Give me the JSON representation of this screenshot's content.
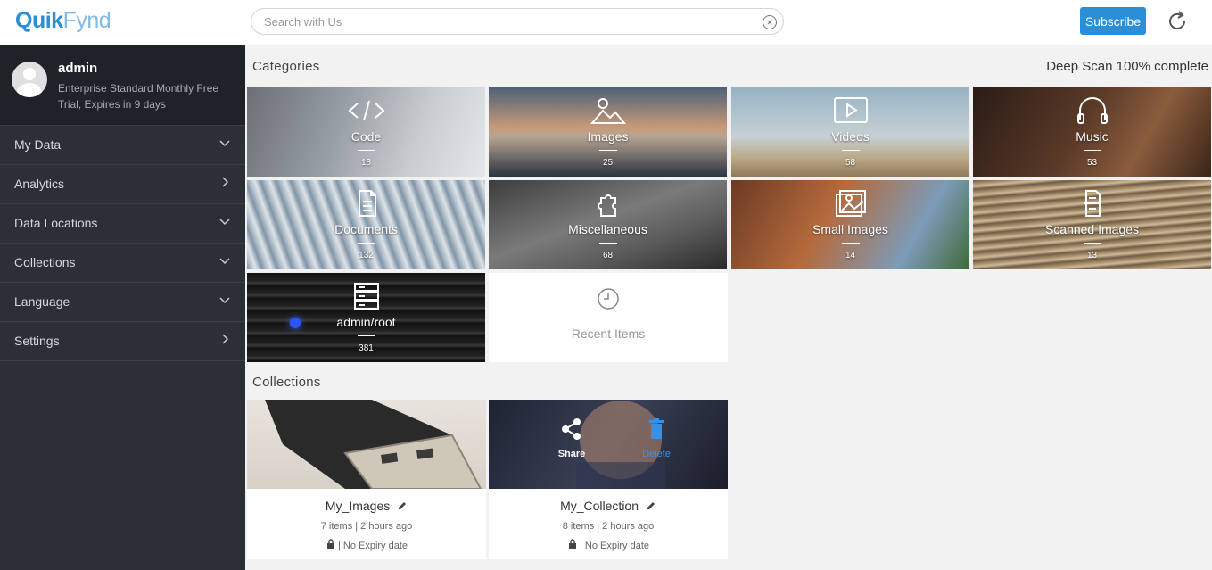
{
  "app": {
    "logo_part1": "Quik",
    "logo_part2": "Fynd",
    "search_placeholder": "Search with Us",
    "subscribe_label": "Subscribe"
  },
  "profile": {
    "username": "admin",
    "plan": "Enterprise Standard Monthly Free Trial, Expires in 9 days"
  },
  "sidebar": {
    "items": [
      {
        "label": "My Data",
        "chevron": "down"
      },
      {
        "label": "Analytics",
        "chevron": "right"
      },
      {
        "label": "Data Locations",
        "chevron": "down"
      },
      {
        "label": "Collections",
        "chevron": "down"
      },
      {
        "label": "Language",
        "chevron": "down"
      },
      {
        "label": "Settings",
        "chevron": "right"
      }
    ]
  },
  "main": {
    "categories_title": "Categories",
    "scan_status": "Deep Scan 100% complete",
    "categories": [
      {
        "name": "Code",
        "count": "18",
        "icon": "code-icon"
      },
      {
        "name": "Images",
        "count": "25",
        "icon": "image-icon"
      },
      {
        "name": "Videos",
        "count": "58",
        "icon": "video-icon"
      },
      {
        "name": "Music",
        "count": "53",
        "icon": "headphones-icon"
      },
      {
        "name": "Documents",
        "count": "132",
        "icon": "document-icon"
      },
      {
        "name": "Miscellaneous",
        "count": "68",
        "icon": "puzzle-icon"
      },
      {
        "name": "Small Images",
        "count": "14",
        "icon": "small-image-icon"
      },
      {
        "name": "Scanned Images",
        "count": "13",
        "icon": "scanned-doc-icon"
      },
      {
        "name": "admin/root",
        "count": "381",
        "icon": "server-icon"
      }
    ],
    "recent_label": "Recent Items",
    "collections_title": "Collections",
    "collections": [
      {
        "name": "My_Images",
        "meta": "7 items  |  2 hours ago",
        "expiry": "|  No Expiry date"
      },
      {
        "name": "My_Collection",
        "meta": "8 items  |  2 hours ago",
        "expiry": "|  No Expiry date"
      }
    ],
    "share_label": "Share",
    "delete_label": "Delete"
  },
  "colors": {
    "brand": "#2a8fd6",
    "sidebar_bg": "#2b2f36",
    "delete_accent": "#3b8fe0"
  }
}
